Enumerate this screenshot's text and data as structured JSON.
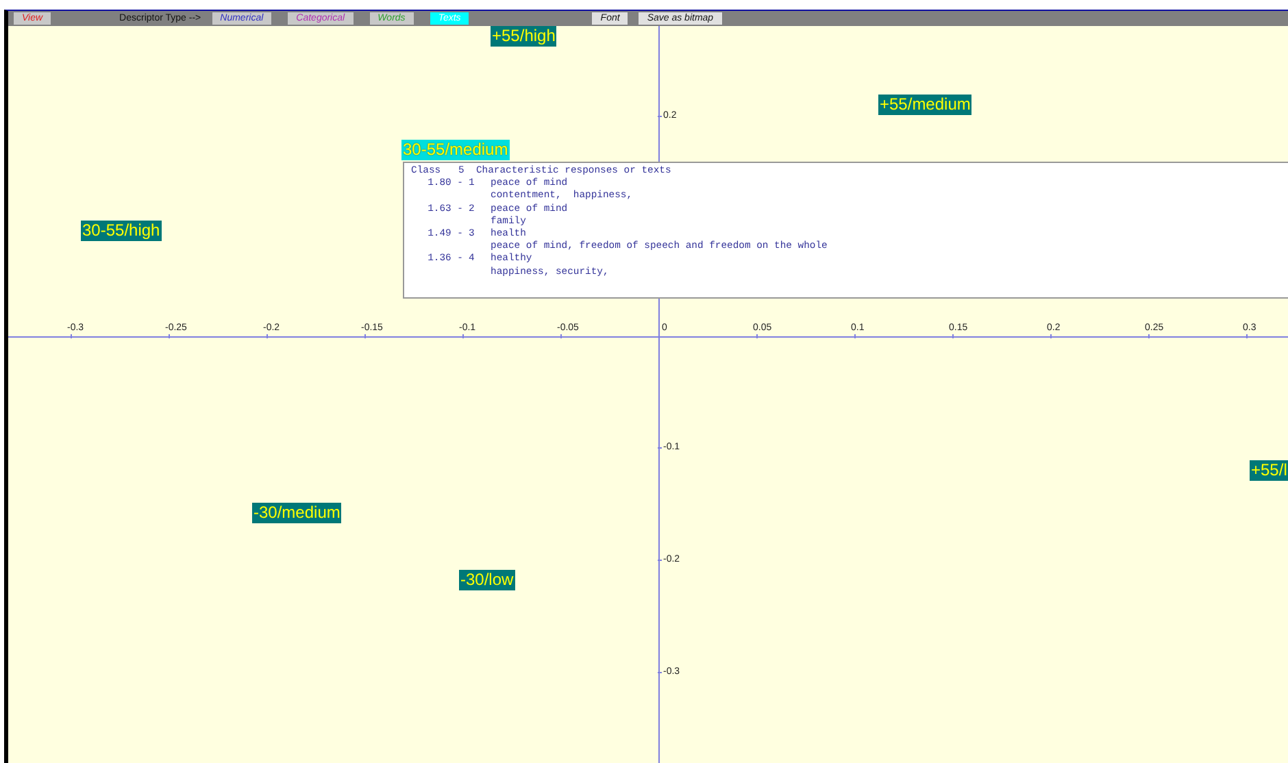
{
  "toolbar": {
    "view_button": "View",
    "descriptor_label": "Descriptor Type -->",
    "descriptor_types": [
      {
        "label": "Numerical",
        "color": "#3030c0",
        "selected": false
      },
      {
        "label": "Categorical",
        "color": "#b030b0",
        "selected": false
      },
      {
        "label": "Words",
        "color": "#30a030",
        "selected": false
      },
      {
        "label": "Texts",
        "color": "#00ffff",
        "selected": true
      }
    ],
    "actions": [
      "Font",
      "Save as bitmap"
    ]
  },
  "plot": {
    "x_axis_labels": [
      "-0.3",
      "-0.25",
      "-0.2",
      "-0.15",
      "-0.1",
      "-0.05",
      "0",
      "0.05",
      "0.1",
      "0.15",
      "0.2",
      "0.25",
      "0.3"
    ],
    "y_axis_labels": [
      "0.2",
      "-0.1",
      "-0.2",
      "-0.3"
    ],
    "class_labels": [
      {
        "text": "+55/high",
        "selected": false
      },
      {
        "text": "+55/medium",
        "selected": false
      },
      {
        "text": "30-55/medium",
        "selected": true
      },
      {
        "text": "30-55/high",
        "selected": false
      },
      {
        "text": "+55/l",
        "selected": false
      },
      {
        "text": "-30/medium",
        "selected": false
      },
      {
        "text": "-30/low",
        "selected": false
      }
    ]
  },
  "popup": {
    "header": "Class   5  Characteristic responses or texts",
    "entries": [
      {
        "score": "1.80 -",
        "rank": "1",
        "response": "peace of mind",
        "text": "contentment,  happiness,"
      },
      {
        "score": "1.63 -",
        "rank": "2",
        "response": "peace of mind",
        "text": "family"
      },
      {
        "score": "1.49 -",
        "rank": "3",
        "response": "health",
        "text": "peace of mind, freedom of speech and freedom on the whole"
      },
      {
        "score": "1.36 -",
        "rank": "4",
        "response": "healthy",
        "text": "happiness, security,"
      }
    ]
  }
}
